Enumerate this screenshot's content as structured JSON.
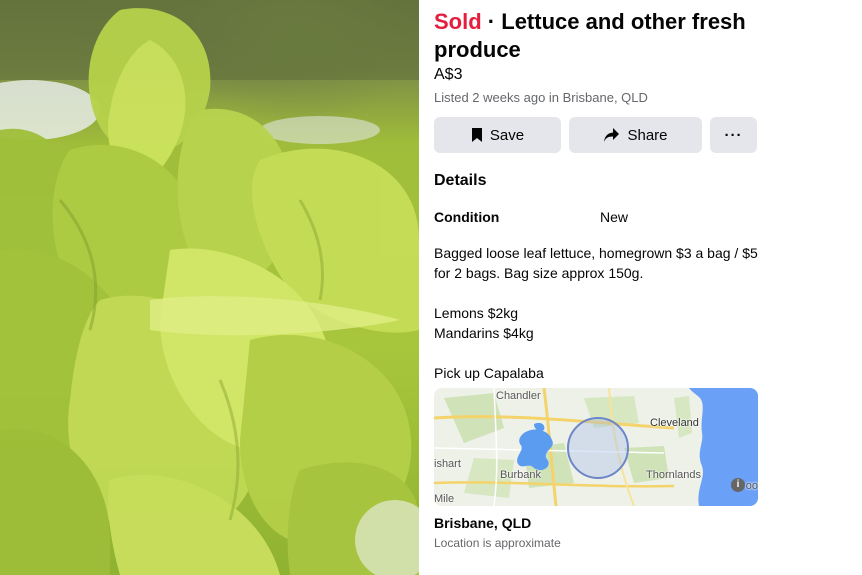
{
  "listing": {
    "status": "Sold",
    "separator": "·",
    "title": "Lettuce and other fresh produce",
    "price": "A$3",
    "listed": "Listed 2 weeks ago in Brisbane, QLD"
  },
  "actions": {
    "save_label": "Save",
    "share_label": "Share",
    "more_label": "···"
  },
  "details": {
    "heading": "Details",
    "condition_label": "Condition",
    "condition_value": "New",
    "description": {
      "line1": "Bagged loose leaf lettuce, homegrown $3 a bag / $5 for 2 bags. Bag size approx 150g.",
      "line2": "Lemons $2kg",
      "line3": "Mandarins $4kg",
      "line4": "Pick up Capalaba"
    }
  },
  "map": {
    "labels": {
      "chandler": "Chandler",
      "cleveland": "Cleveland",
      "burbank": "Burbank",
      "thornlands": "Thornlands",
      "mshart": "ishart",
      "mile": "Mile",
      "boo": "oo"
    },
    "info": "i"
  },
  "location": {
    "name": "Brisbane, QLD",
    "note": "Location is approximate"
  },
  "colors": {
    "sold": "#e41e3f",
    "button_bg": "#e4e6eb",
    "muted_text": "#65676b",
    "water": "#6aa0f5"
  }
}
